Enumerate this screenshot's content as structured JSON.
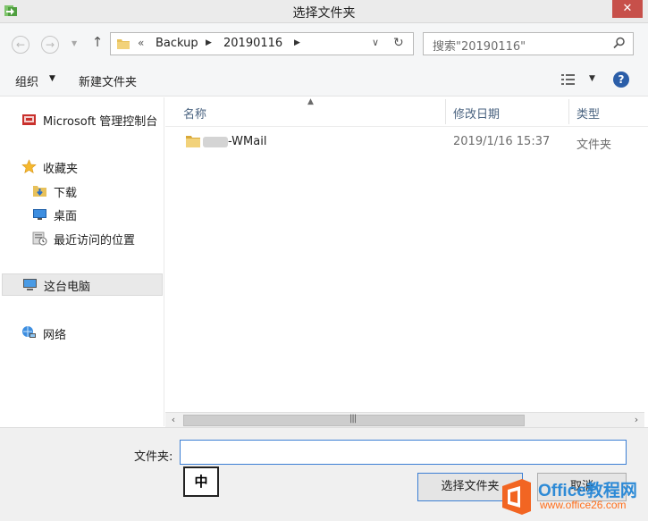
{
  "window": {
    "title": "选择文件夹",
    "close_label": "✕"
  },
  "nav": {
    "back_icon": "back-arrow-icon",
    "forward_icon": "forward-arrow-icon",
    "up_icon": "up-arrow-icon",
    "address": {
      "overflow": "«",
      "segments": [
        "Backup",
        "20190116"
      ]
    },
    "search": {
      "placeholder": "搜索\"20190116\""
    }
  },
  "toolbar": {
    "organize_label": "组织",
    "new_folder_label": "新建文件夹",
    "help_label": "?"
  },
  "sidebar": {
    "items": [
      {
        "label": "Microsoft 管理控制台",
        "icon": "mmc-icon"
      },
      {
        "label": "收藏夹",
        "icon": "star-icon"
      },
      {
        "label": "下载",
        "icon": "download-folder-icon"
      },
      {
        "label": "桌面",
        "icon": "desktop-icon"
      },
      {
        "label": "最近访问的位置",
        "icon": "recent-places-icon"
      },
      {
        "label": "这台电脑",
        "icon": "computer-icon"
      },
      {
        "label": "网络",
        "icon": "network-icon"
      }
    ]
  },
  "filelist": {
    "columns": [
      "名称",
      "修改日期",
      "类型"
    ],
    "rows": [
      {
        "name": "-WMail",
        "modified": "2019/1/16 15:37",
        "type": "文件夹"
      }
    ]
  },
  "bottom": {
    "folder_label": "文件夹:",
    "folder_value": "",
    "ime_indicator": "中",
    "select_button": "选择文件夹",
    "cancel_button": "取消"
  },
  "watermark": {
    "line1": "Office教程网",
    "line2": "www.office26.com"
  },
  "colors": {
    "accent": "#3c7fd4",
    "close_button": "#c7504a",
    "header_text": "#4a6380",
    "folder_yellow": "#e8c15a",
    "watermark_blue": "#2d8ad6",
    "watermark_orange": "#ff6e1a"
  }
}
